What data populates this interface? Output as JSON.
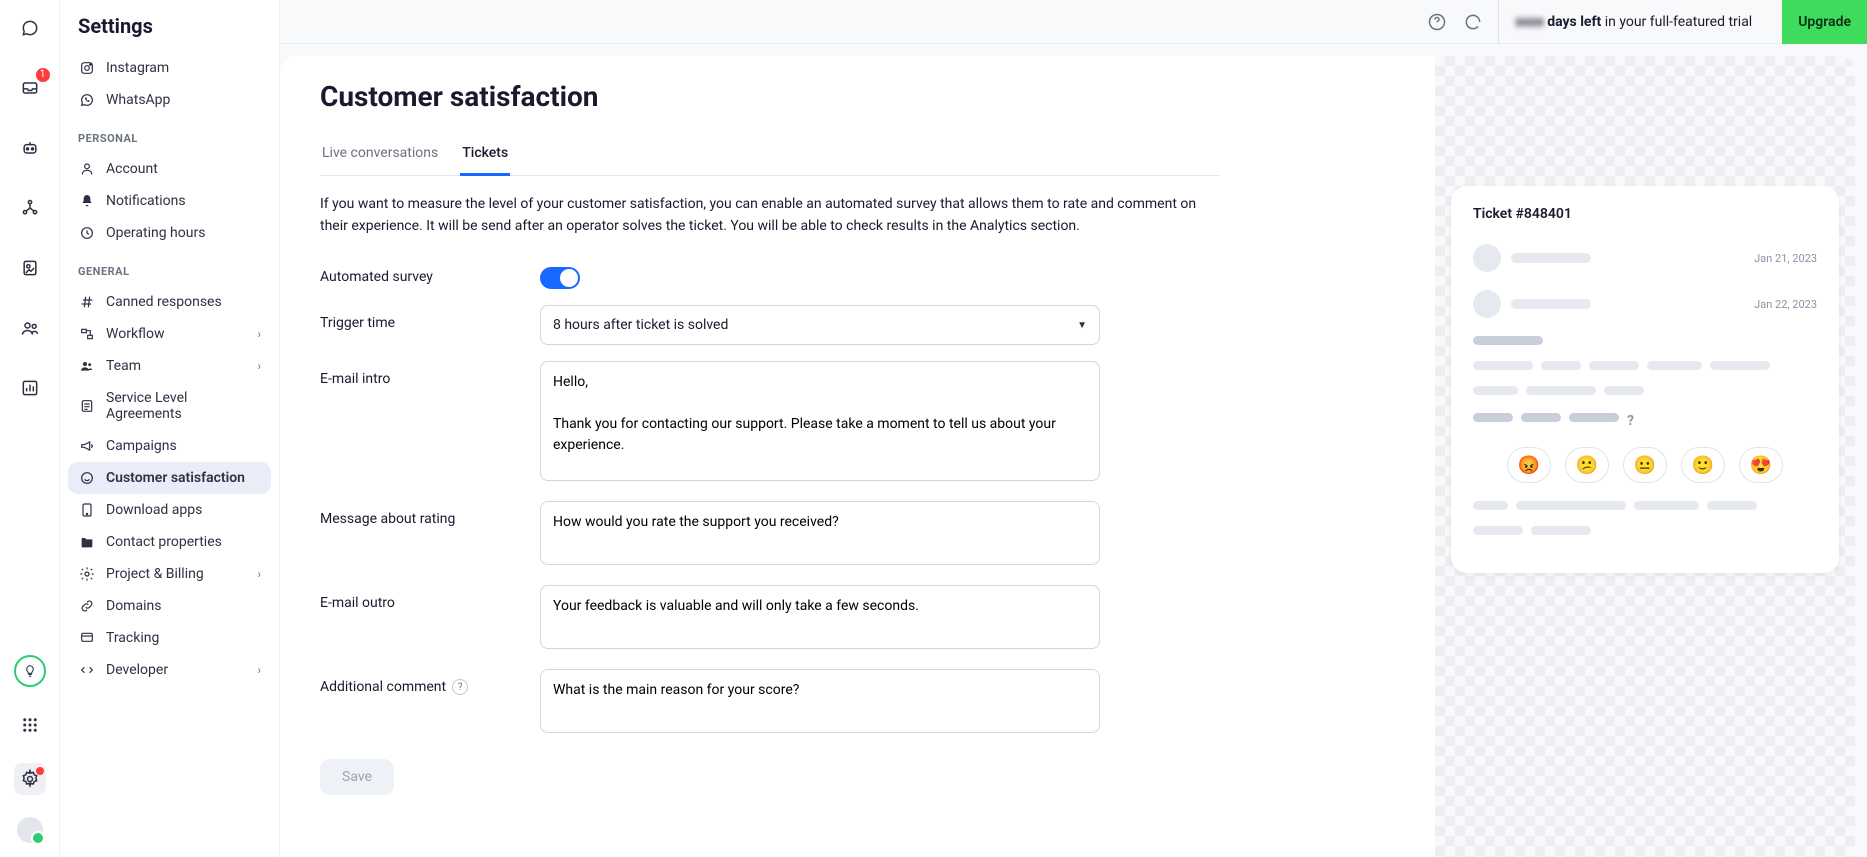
{
  "rail": {
    "inbox_badge": "1"
  },
  "sidebar": {
    "title": "Settings",
    "channels": [
      {
        "label": "Instagram"
      },
      {
        "label": "WhatsApp"
      }
    ],
    "sections": {
      "personal_label": "PERSONAL",
      "general_label": "GENERAL"
    },
    "personal": [
      {
        "label": "Account"
      },
      {
        "label": "Notifications"
      },
      {
        "label": "Operating hours"
      }
    ],
    "general": [
      {
        "label": "Canned responses"
      },
      {
        "label": "Workflow",
        "chevron": true
      },
      {
        "label": "Team",
        "chevron": true
      },
      {
        "label": "Service Level Agreements"
      },
      {
        "label": "Campaigns"
      },
      {
        "label": "Customer satisfaction",
        "active": true
      },
      {
        "label": "Download apps"
      },
      {
        "label": "Contact properties"
      },
      {
        "label": "Project & Billing",
        "chevron": true
      },
      {
        "label": "Domains"
      },
      {
        "label": "Tracking"
      },
      {
        "label": "Developer",
        "chevron": true
      }
    ]
  },
  "header": {
    "trial_text_suffix": " in your full-featured trial",
    "trial_bold": "days left",
    "upgrade_label": "Upgrade"
  },
  "page": {
    "title": "Customer satisfaction",
    "tabs": [
      {
        "label": "Live conversations",
        "active": false
      },
      {
        "label": "Tickets",
        "active": true
      }
    ],
    "description": "If you want to measure the level of your customer satisfaction, you can enable an automated survey that allows them to rate and comment on their experience. It will be send after an operator solves the ticket. You will be able to check results in the Analytics section.",
    "form": {
      "automated_label": "Automated survey",
      "trigger_label": "Trigger time",
      "trigger_value": "8 hours after ticket is solved",
      "intro_label": "E-mail intro",
      "intro_value": "Hello,\n\nThank you for contacting our support. Please take a moment to tell us about your experience.",
      "rating_label": "Message about rating",
      "rating_value": "How would you rate the support you received?",
      "outro_label": "E-mail outro",
      "outro_value": "Your feedback is valuable and will only take a few seconds.",
      "additional_label": "Additional comment",
      "additional_value": "What is the main reason for your score?",
      "save_label": "Save"
    }
  },
  "preview": {
    "title": "Ticket #848401",
    "dates": [
      "Jan 21, 2023",
      "Jan 22, 2023"
    ],
    "emojis": [
      "😡",
      "😕",
      "😐",
      "🙂",
      "😍"
    ],
    "question_mark": "?"
  }
}
